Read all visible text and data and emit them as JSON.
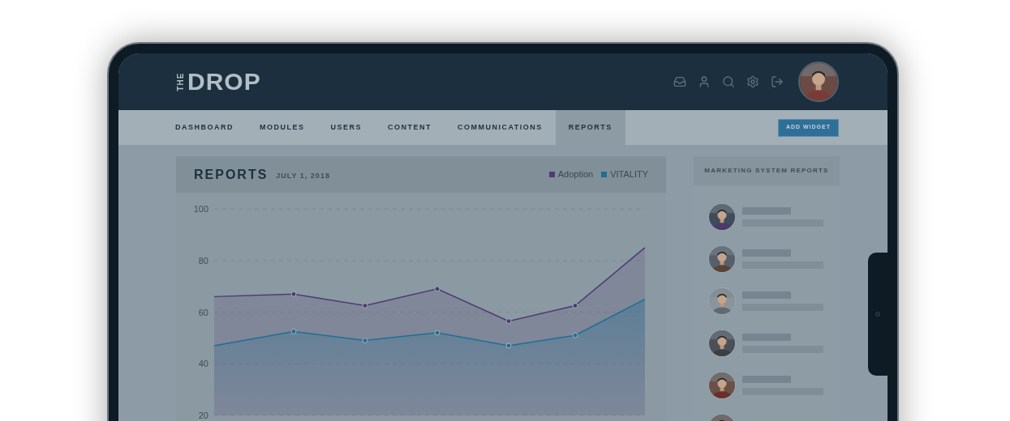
{
  "header": {
    "logo_side": "THE",
    "logo_main": "DROP"
  },
  "nav": {
    "tabs": [
      {
        "label": "DASHBOARD",
        "selected": false
      },
      {
        "label": "MODULES",
        "selected": false
      },
      {
        "label": "USERS",
        "selected": false
      },
      {
        "label": "CONTENT",
        "selected": false
      },
      {
        "label": "COMMUNICATIONS",
        "selected": false
      },
      {
        "label": "REPORTS",
        "selected": true
      }
    ],
    "add_button": "ADD WIDGET"
  },
  "reports": {
    "title": "REPORTS",
    "date": "JULY 1, 2018",
    "chart_data": {
      "type": "area",
      "grid": true,
      "ylim": [
        20,
        100
      ],
      "yticks": [
        20,
        40,
        60,
        80,
        100
      ],
      "series": [
        {
          "name": "Adoption",
          "color": "#4e3a74",
          "values": [
            66,
            67,
            62.5,
            69,
            56.5,
            62.5,
            85
          ]
        },
        {
          "name": "VITALITY",
          "color": "#1e6f94",
          "values": [
            47,
            52.5,
            49,
            52,
            47,
            51,
            65
          ]
        }
      ]
    }
  },
  "side_panel": {
    "title": "MARKETING SYSTEM REPORTS"
  }
}
